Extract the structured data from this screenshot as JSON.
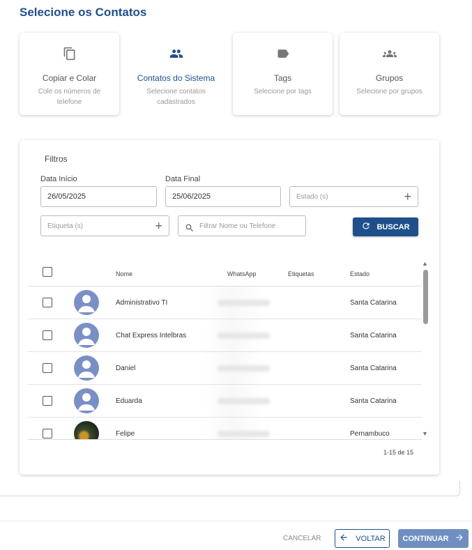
{
  "page_title": "Selecione os Contatos",
  "cards": [
    {
      "title": "Copiar e Colar",
      "subtitle": "Cole os números de telefone",
      "icon": "copy-icon"
    },
    {
      "title": "Contatos do Sistema",
      "subtitle": "Selecione contatos cadastrados",
      "icon": "people-icon",
      "active": true
    },
    {
      "title": "Tags",
      "subtitle": "Selecione por tags",
      "icon": "tag-icon"
    },
    {
      "title": "Grupos",
      "subtitle": "Selecione por grupos",
      "icon": "groups-icon"
    }
  ],
  "filters": {
    "heading": "Filtros",
    "start_label": "Data Início",
    "start_value": "26/05/2025",
    "end_label": "Data Final",
    "end_value": "25/06/2025",
    "state_placeholder": "Estado (s)",
    "tag_placeholder": "Etiqueta (s)",
    "search_placeholder": "Filtrar Nome ou Telefone",
    "search_button": "BUSCAR"
  },
  "table": {
    "columns": {
      "name": "Nome",
      "whatsapp": "WhatsApp",
      "tags": "Etiquetas",
      "state": "Estado"
    },
    "rows": [
      {
        "name": "Administrativo TI",
        "state": "Santa Catarina"
      },
      {
        "name": "Chat Express Intelbras",
        "state": "Santa Catarina"
      },
      {
        "name": "Daniel",
        "state": "Santa Catarina"
      },
      {
        "name": "Eduarda",
        "state": "Santa Catarina"
      },
      {
        "name": "Felipe",
        "state": "Pernambuco"
      }
    ],
    "pagination": "1-15 de 15"
  },
  "footer": {
    "cancel": "CANCELAR",
    "back": "VOLTAR",
    "continue": "CONTINUAR"
  },
  "colors": {
    "primary": "#1f4f8a",
    "continue_bg": "#6f8fc2"
  }
}
